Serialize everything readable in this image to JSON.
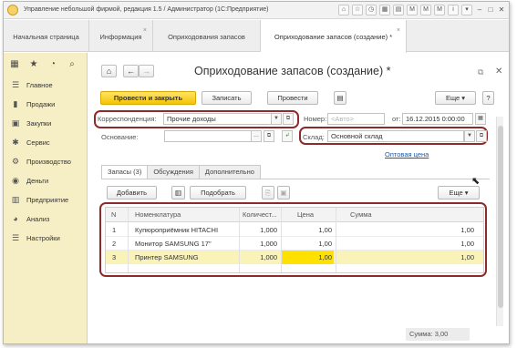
{
  "window": {
    "title": "Управление небольшой фирмой, редакция 1.5 / Администратор (1С:Предприятие)"
  },
  "tabs": [
    {
      "label": "Начальная страница"
    },
    {
      "label": "Информация"
    },
    {
      "label": "Оприходования запасов"
    },
    {
      "label": "Оприходование запасов (создание) *"
    }
  ],
  "sidebar": {
    "items": [
      {
        "label": "Главное",
        "icon": "list-icon"
      },
      {
        "label": "Продажи",
        "icon": "sales-icon"
      },
      {
        "label": "Закупки",
        "icon": "purchases-icon"
      },
      {
        "label": "Сервис",
        "icon": "service-icon"
      },
      {
        "label": "Производство",
        "icon": "production-icon"
      },
      {
        "label": "Деньги",
        "icon": "money-icon"
      },
      {
        "label": "Предприятие",
        "icon": "enterprise-icon"
      },
      {
        "label": "Анализ",
        "icon": "analysis-icon"
      },
      {
        "label": "Настройки",
        "icon": "settings-icon"
      }
    ]
  },
  "form": {
    "title": "Оприходование запасов (создание) *",
    "buttons": {
      "post_close": "Провести и закрыть",
      "save": "Записать",
      "post": "Провести",
      "more": "Еще",
      "help": "?"
    },
    "fields": {
      "correspondence_label": "Корреспонденция:",
      "correspondence_value": "Прочие доходы",
      "number_label": "Номер:",
      "number_placeholder": "<Авто>",
      "date_label": "от:",
      "date_value": "16.12.2015  0:00:00",
      "basis_label": "Основание:",
      "basis_value": "",
      "warehouse_label": "Склад:",
      "warehouse_value": "Основной склад",
      "price_link": "Оптовая цена"
    },
    "inner_tabs": [
      {
        "label": "Запасы (3)"
      },
      {
        "label": "Обсуждения"
      },
      {
        "label": "Дополнительно"
      }
    ],
    "table_buttons": {
      "add": "Добавить",
      "pick": "Подобрать",
      "more": "Еще"
    },
    "table": {
      "columns": [
        "N",
        "Номенклатура",
        "Количест...",
        "Цена",
        "Сумма"
      ],
      "rows": [
        {
          "n": "1",
          "item": "Купюроприёмник HITACHI",
          "qty": "1,000",
          "price": "1,00",
          "sum": "1,00"
        },
        {
          "n": "2",
          "item": "Монитор SAMSUNG 17\"",
          "qty": "1,000",
          "price": "1,00",
          "sum": "1,00"
        },
        {
          "n": "3",
          "item": "Принтер SAMSUNG",
          "qty": "1,000",
          "price": "1,00",
          "sum": "1,00"
        }
      ]
    },
    "total": "Сумма:  3,00"
  },
  "colors": {
    "sidebar_bg": "#f6eec4",
    "primary_button": "#f5c400",
    "highlight_oval": "#8e2a2a",
    "selected_row": "#faf3b8",
    "price_highlight": "#ffe100",
    "link": "#1f5aa5"
  }
}
